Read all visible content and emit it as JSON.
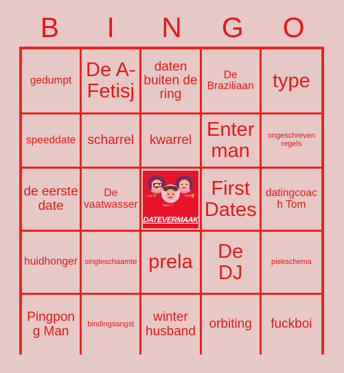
{
  "card": {
    "title_letters": [
      "B",
      "I",
      "N",
      "G",
      "O"
    ],
    "colors": {
      "background": "#e6c9c6",
      "grid_line": "#ee2020",
      "text": "#e81717",
      "logo_background": "#e8152a"
    }
  },
  "grid": {
    "rows": 5,
    "columns": 5,
    "cells": [
      {
        "text": "gedumpt",
        "size": "s",
        "type": "text"
      },
      {
        "text": "De A-Fetisj",
        "size": "xl",
        "type": "text"
      },
      {
        "text": "daten buiten de ring",
        "size": "m",
        "type": "text"
      },
      {
        "text": "De Braziliaan",
        "size": "s",
        "type": "text"
      },
      {
        "text": "type",
        "size": "xl",
        "type": "text"
      },
      {
        "text": "speeddate",
        "size": "s",
        "type": "text"
      },
      {
        "text": "scharrel",
        "size": "m",
        "type": "text"
      },
      {
        "text": "kwarrel",
        "size": "m",
        "type": "text"
      },
      {
        "text": "Enter man",
        "size": "xl",
        "type": "text"
      },
      {
        "text": "ongeschreven regels",
        "size": "xs",
        "type": "text"
      },
      {
        "text": "de eerste date",
        "size": "m",
        "type": "text"
      },
      {
        "text": "De vaatwasser",
        "size": "s",
        "type": "text"
      },
      {
        "text": "",
        "size": "s",
        "type": "image"
      },
      {
        "text": "First Dates",
        "size": "xl",
        "type": "text"
      },
      {
        "text": "datingcoach Tom",
        "size": "s",
        "type": "text"
      },
      {
        "text": "huidhonger",
        "size": "s",
        "type": "text"
      },
      {
        "text": "singleschaamte",
        "size": "xs",
        "type": "text"
      },
      {
        "text": "prela",
        "size": "xl",
        "type": "text"
      },
      {
        "text": "De DJ",
        "size": "xl",
        "type": "text"
      },
      {
        "text": "piekschema",
        "size": "xs",
        "type": "text"
      },
      {
        "text": "Pingpong Man",
        "size": "m",
        "type": "text"
      },
      {
        "text": "bindingsangst",
        "size": "xs",
        "type": "text"
      },
      {
        "text": "winter husband",
        "size": "m",
        "type": "text"
      },
      {
        "text": "orbiting",
        "size": "m",
        "type": "text"
      },
      {
        "text": "fuckboi",
        "size": "m",
        "type": "text"
      }
    ]
  },
  "free_space_logo": {
    "wordmark": "DATEVERMAAK",
    "hosts": [
      {
        "caption": "Lisa",
        "emoji": "🌻"
      },
      {
        "caption": "Rens",
        "emoji": "💋"
      },
      {
        "caption": "Fadi",
        "emoji": "🍔"
      }
    ]
  }
}
